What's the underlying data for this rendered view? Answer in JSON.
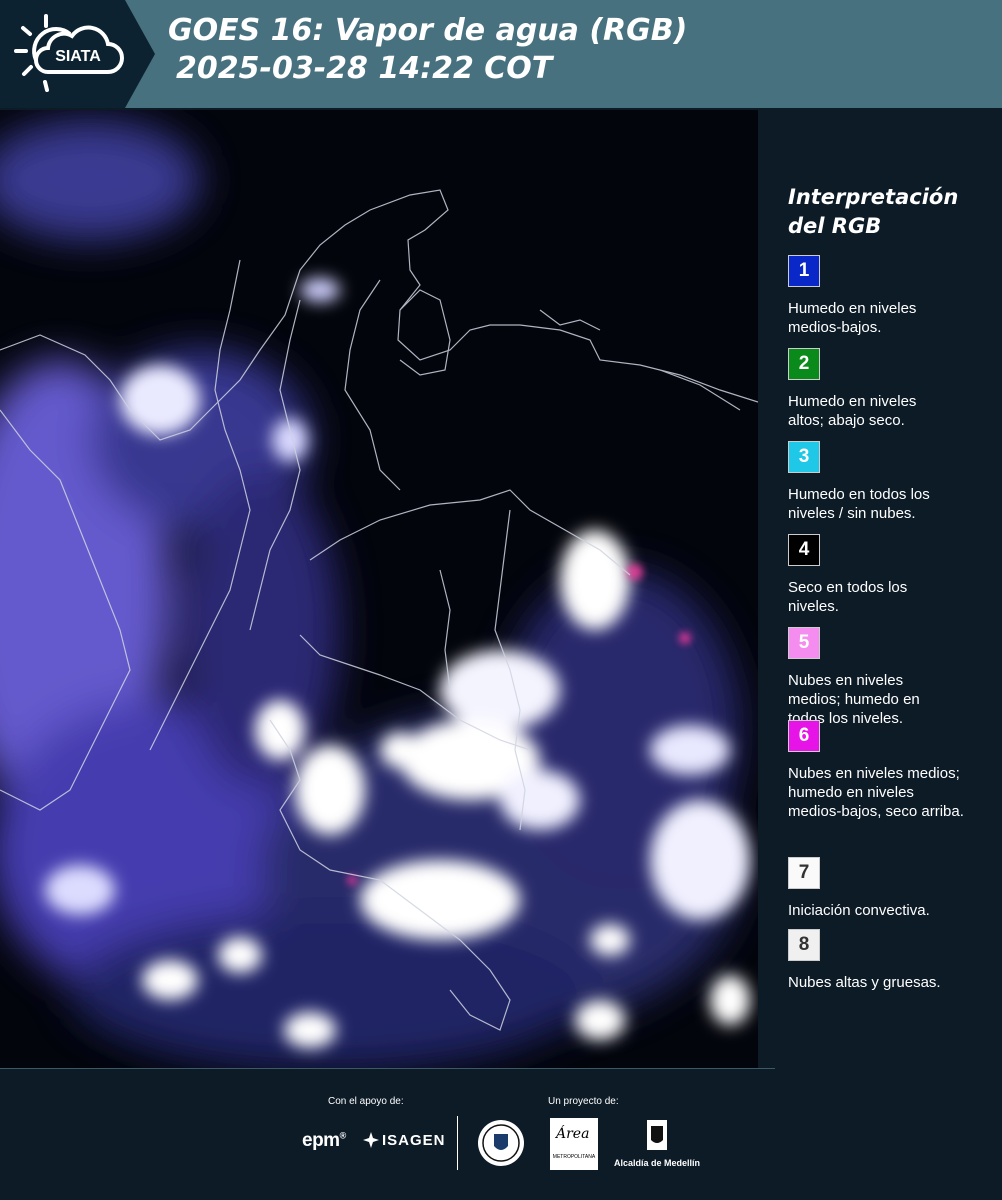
{
  "header": {
    "logo_text": "SIATA",
    "title_line1": "GOES 16: Vapor de agua (RGB)",
    "title_line2": "2025-03-28 14:22 COT"
  },
  "legend": {
    "title_line1": "Interpretación",
    "title_line2": "del RGB",
    "items": [
      {
        "number": "1",
        "color": "#0a28c8",
        "text_color": "#ffffff",
        "lines": [
          "Humedo en niveles",
          "medios-bajos."
        ]
      },
      {
        "number": "2",
        "color": "#0b8a1c",
        "text_color": "#ffffff",
        "lines": [
          "Humedo en niveles",
          "altos; abajo seco."
        ]
      },
      {
        "number": "3",
        "color": "#1ec8e6",
        "text_color": "#ffffff",
        "lines": [
          "Humedo en todos los",
          "niveles / sin nubes."
        ]
      },
      {
        "number": "4",
        "color": "#000000",
        "text_color": "#ffffff",
        "lines": [
          "Seco en todos los",
          "niveles."
        ]
      },
      {
        "number": "5",
        "color": "#f58cf0",
        "text_color": "#ffffff",
        "lines": [
          "Nubes en niveles",
          "medios; humedo en",
          "todos los niveles."
        ]
      },
      {
        "number": "6",
        "color": "#e614e6",
        "text_color": "#ffffff",
        "lines": [
          "Nubes en niveles medios;",
          "humedo en niveles",
          "medios-bajos, seco arriba."
        ]
      },
      {
        "number": "7",
        "color": "#fafafa",
        "text_color": "#333333",
        "lines": [
          "Iniciación convectiva."
        ]
      },
      {
        "number": "8",
        "color": "#f0f0f0",
        "text_color": "#333333",
        "lines": [
          "Nubes altas y gruesas."
        ]
      }
    ]
  },
  "footer": {
    "support_label": "Con el apoyo de:",
    "project_label": "Un proyecto de:",
    "epm_logo_text": "epm",
    "isagen_logo_text": "ISAGEN",
    "area_logo_text": "Área",
    "metro_logo_text": "METROPOLITANA",
    "alcaldia_text": "Alcaldía de Medellín"
  },
  "icons": {
    "logo": "sun-cloud-logo-icon",
    "isagen": "isagen-star-icon",
    "seal": "medellin-seal-icon",
    "shield": "medellin-shield-icon"
  }
}
